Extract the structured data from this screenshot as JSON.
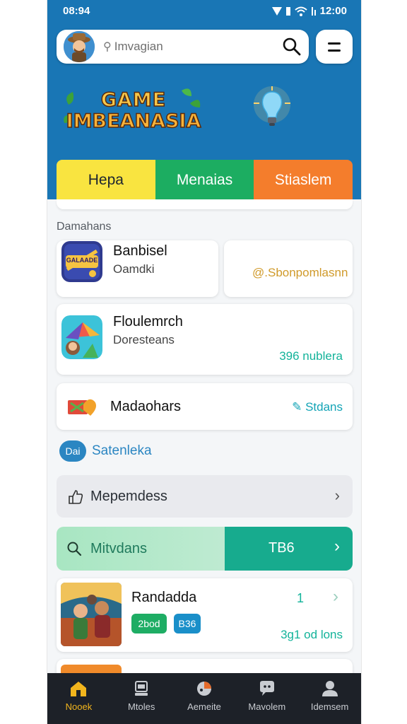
{
  "status_bar": {
    "time": "08:94",
    "clock": "12:00"
  },
  "search": {
    "placeholder": "Imvagian"
  },
  "logo": {
    "line1": "GAME",
    "line2": "IMBEANASIA"
  },
  "tabs": [
    {
      "label": "Hepa"
    },
    {
      "label": "Menaias"
    },
    {
      "label": "Stiaslem"
    }
  ],
  "section_title": "Damahans",
  "cards": {
    "banbisel": {
      "title": "Banbisel",
      "subtitle": "Oamdki",
      "side_text": "@.Sbonpomlasnn",
      "icon_text": "GALAADE"
    },
    "floulemarch": {
      "title": "Floulemrch",
      "subtitle": "Doresteans",
      "meta": "396 nublera"
    },
    "madaohars": {
      "title": "Madaohars",
      "meta": "Stdans"
    }
  },
  "badge_row": {
    "badge": "Dai",
    "label": "Satenleka"
  },
  "list_rows": {
    "mepemdess": {
      "label": "Mepemdess"
    },
    "mitvdans": {
      "label": "Mitvdans",
      "value": "TB6"
    }
  },
  "randadda": {
    "title": "Randadda",
    "count": "1",
    "tag1": "2bod",
    "tag2": "B36",
    "meta": "3g1 od lons"
  },
  "bottom_nav": [
    {
      "label": "Nooek"
    },
    {
      "label": "Mtoles"
    },
    {
      "label": "Aemeite"
    },
    {
      "label": "Mavolem"
    },
    {
      "label": "Idemsem"
    }
  ],
  "colors": {
    "header_blue": "#1976b5",
    "tab_yellow": "#f9e440",
    "tab_green": "#1cad61",
    "tab_orange": "#f47d2c",
    "accent_teal": "#13b39a",
    "nav_active": "#f2b51d"
  },
  "icons": [
    "signal-icon",
    "wifi-icon",
    "search-icon",
    "menu-icon",
    "lightbulb-icon",
    "thumbs-up-icon",
    "chevron-right-icon",
    "home-icon",
    "trophy-icon",
    "pizza-icon",
    "chat-icon",
    "user-icon"
  ]
}
